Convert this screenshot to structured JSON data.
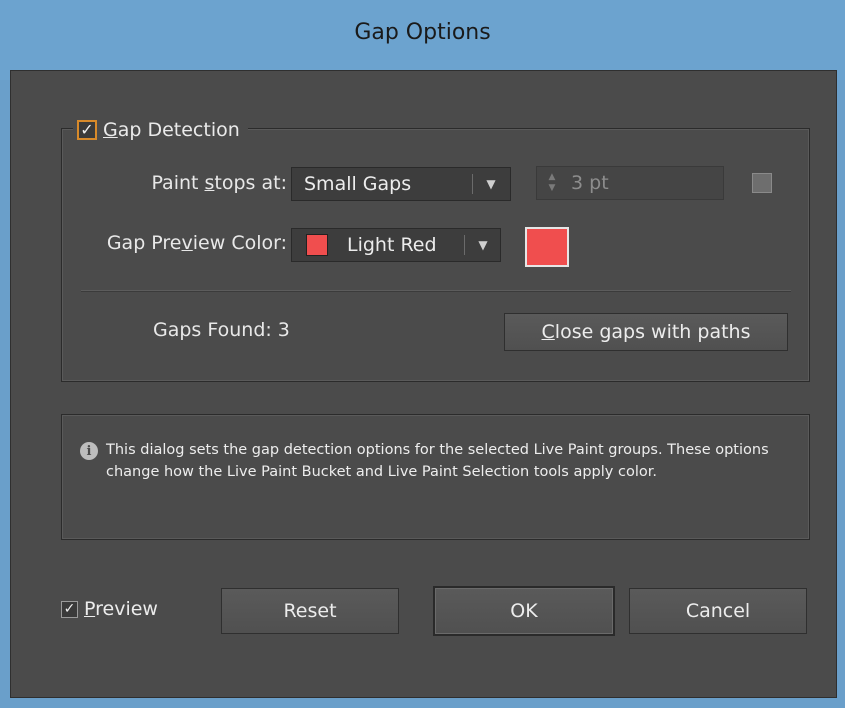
{
  "window": {
    "title": "Gap Options"
  },
  "gap_detection": {
    "label": "Gap Detection",
    "label_first": "G",
    "label_rest": "ap Detection",
    "checked": true,
    "check_glyph": "✓"
  },
  "paint_stops": {
    "label_pre": "Paint ",
    "label_u": "s",
    "label_post": "tops at:",
    "selected": "Small Gaps",
    "spinner_value": "3 pt"
  },
  "preview_color": {
    "label_pre": "Gap Pre",
    "label_u": "v",
    "label_post": "iew Color:",
    "selected": "Light Red",
    "swatch_color": "#f04e4e"
  },
  "gaps_found": {
    "label": "Gaps Found:",
    "count": "3"
  },
  "close_gaps_button": {
    "label_u": "C",
    "label_rest": "lose gaps with paths"
  },
  "info": {
    "icon": "info-icon",
    "text": "This dialog sets the gap detection options for the selected Live Paint groups. These options change how the Live Paint Bucket and Live Paint Selection tools apply color."
  },
  "footer": {
    "preview_label_u": "P",
    "preview_label_rest": "review",
    "preview_checked": true,
    "check_glyph": "✓",
    "reset_label": "Reset",
    "ok_label": "OK",
    "cancel_label": "Cancel"
  },
  "colors": {
    "accent": "#6ca3cf",
    "panel": "#4b4b4b",
    "swatch": "#f04e4e",
    "checkbox_focus": "#d88a2a"
  }
}
